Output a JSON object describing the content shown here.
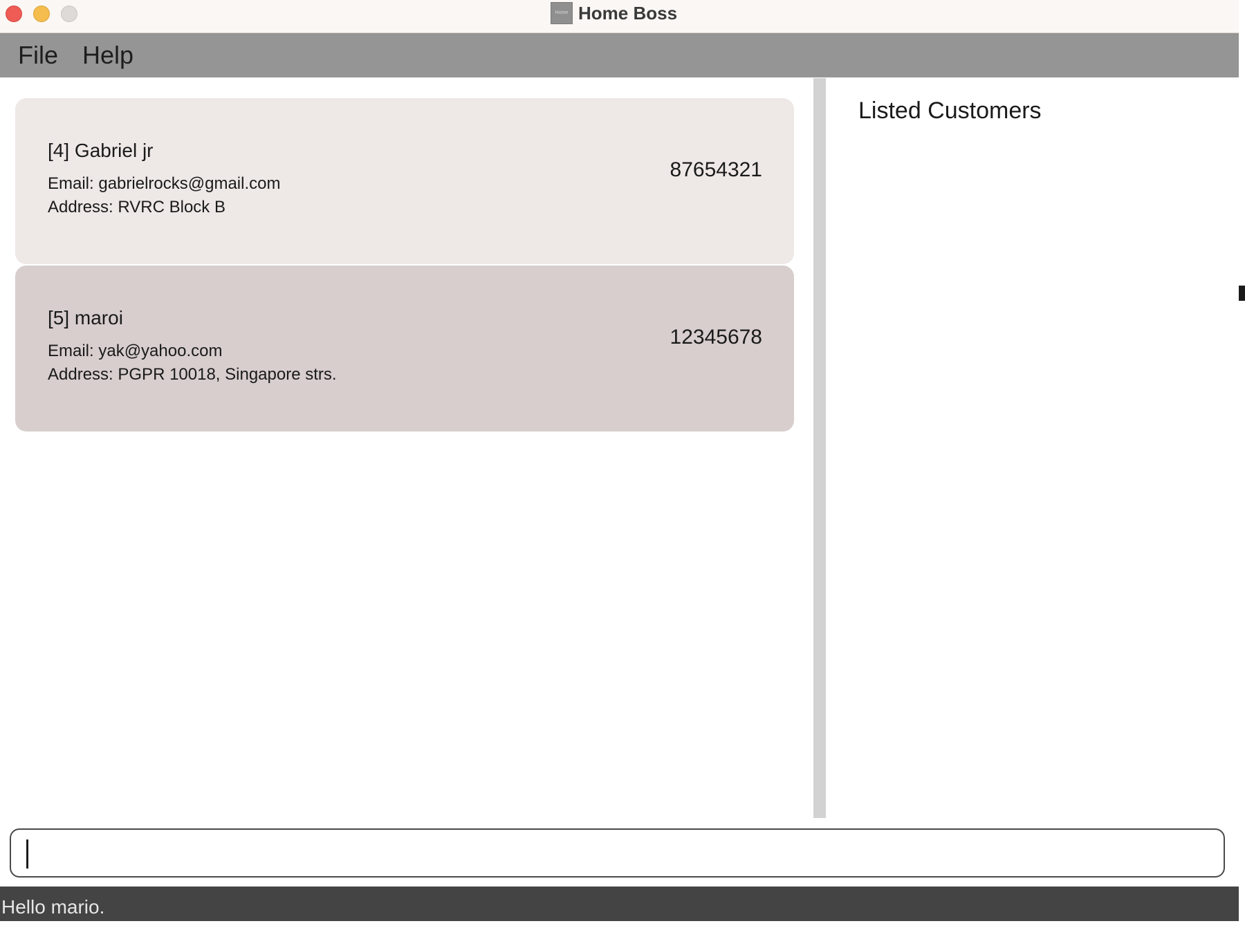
{
  "window": {
    "title": "Home Boss",
    "icon_name": "app-icon",
    "icon_text": "Home"
  },
  "menu": {
    "items": [
      {
        "label": "File"
      },
      {
        "label": "Help"
      }
    ]
  },
  "customers": [
    {
      "name": "[4] Gabriel jr",
      "email": "Email: gabrielrocks@gmail.com",
      "address": "Address: RVRC Block B",
      "phone": "87654321"
    },
    {
      "name": "[5] maroi",
      "email": "Email: yak@yahoo.com",
      "address": "Address: PGPR 10018, Singapore strs.",
      "phone": "12345678"
    }
  ],
  "right_panel": {
    "title": "Listed Customers"
  },
  "command": {
    "value": "",
    "placeholder": ""
  },
  "status": {
    "text": "Hello mario."
  },
  "colors": {
    "titlebar": "#fbf7f4",
    "menubar": "#959595",
    "card_selected": "#eee8e7",
    "card_alt": "#d7cecd",
    "statusbar": "#444444",
    "close": "#ee5c55",
    "minimize": "#f5bd4e",
    "maximize": "#dddad7"
  }
}
